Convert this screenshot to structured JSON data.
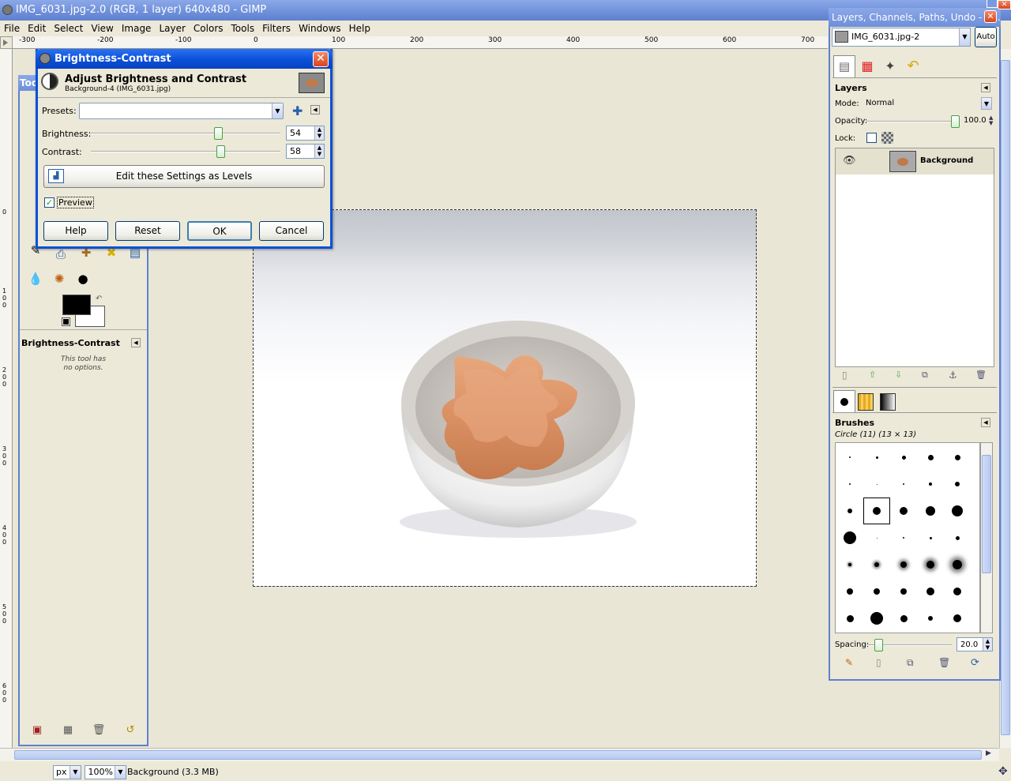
{
  "window": {
    "title": "IMG_6031.jpg-2.0 (RGB, 1 layer) 640x480 - GIMP"
  },
  "menu": [
    "File",
    "Edit",
    "Select",
    "View",
    "Image",
    "Layer",
    "Colors",
    "Tools",
    "Filters",
    "Windows",
    "Help"
  ],
  "hruler": {
    "labels": [
      "-300",
      "-200",
      "-100",
      "0",
      "100",
      "200",
      "300",
      "400",
      "500",
      "600",
      "700"
    ]
  },
  "vruler": {
    "labels": [
      "0",
      "1\n0\n0",
      "2\n0\n0",
      "3\n0\n0",
      "4\n0\n0",
      "5\n0\n0",
      "6\n0\n0"
    ]
  },
  "toolbox": {
    "title": "Tool",
    "options_title": "Brightness-Contrast",
    "options_text_1": "This tool has",
    "options_text_2": "no options."
  },
  "dialog": {
    "title": "Brightness-Contrast",
    "heading": "Adjust Brightness and Contrast",
    "subheading": "Background-4 (IMG_6031.jpg)",
    "presets_label": "Presets:",
    "presets_value": "",
    "brightness_label": "Brightness:",
    "brightness_value": "54",
    "brightness": 54,
    "contrast_label": "Contrast:",
    "contrast_value": "58",
    "contrast": 58,
    "levels_button": "Edit these Settings as Levels",
    "preview_label": "Preview",
    "preview_checked": true,
    "help": "Help",
    "reset": "Reset",
    "ok": "OK",
    "cancel": "Cancel"
  },
  "dock": {
    "title": "Layers, Channels, Paths, Undo - B...",
    "image_combo": "IMG_6031.jpg-2",
    "auto": "Auto",
    "layers_title": "Layers",
    "mode_label": "Mode:",
    "mode_value": "Normal",
    "opacity_label": "Opacity:",
    "opacity_value": "100.0",
    "lock_label": "Lock:",
    "layer_name": "Background",
    "brushes_title": "Brushes",
    "brush_info": "Circle (11) (13 × 13)",
    "spacing_label": "Spacing:",
    "spacing_value": "20.0"
  },
  "status": {
    "unit": "px",
    "zoom": "100%",
    "info": "Background (3.3 MB)"
  },
  "colors": {
    "accent": "#0a50d8",
    "title_bg": "#6e8fd9",
    "fg": "#000000",
    "bg": "#ffffff"
  }
}
